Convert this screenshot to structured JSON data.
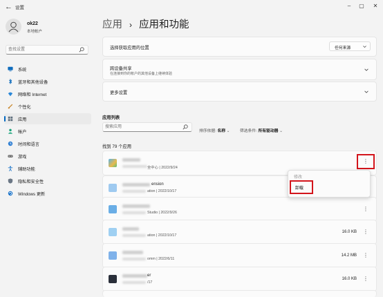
{
  "window": {
    "app_title": "设置",
    "back_icon": "back-arrow-icon",
    "controls": [
      "–",
      "▢",
      "✕"
    ]
  },
  "profile": {
    "name": "ok22",
    "account_type": "本地帐户"
  },
  "search": {
    "placeholder": "查找设置"
  },
  "sidebar": {
    "items": [
      {
        "label": "系统",
        "icon": "monitor-icon",
        "color": "#0f6cbd"
      },
      {
        "label": "蓝牙和其他设备",
        "icon": "bluetooth-icon",
        "color": "#0f6cbd"
      },
      {
        "label": "网络和 Internet",
        "icon": "wifi-icon",
        "color": "#2b88d8"
      },
      {
        "label": "个性化",
        "icon": "brush-icon",
        "color": "#c8862a"
      },
      {
        "label": "应用",
        "icon": "apps-icon",
        "color": "#5b6b7a",
        "active": true
      },
      {
        "label": "帐户",
        "icon": "person-icon",
        "color": "#1aa37a"
      },
      {
        "label": "时间和语言",
        "icon": "globe-clock-icon",
        "color": "#2f7fd3"
      },
      {
        "label": "游戏",
        "icon": "gamepad-icon",
        "color": "#6b6b6b"
      },
      {
        "label": "辅助功能",
        "icon": "accessibility-icon",
        "color": "#1a73c9"
      },
      {
        "label": "隐私和安全性",
        "icon": "shield-icon",
        "color": "#6b7785"
      },
      {
        "label": "Windows 更新",
        "icon": "update-icon",
        "color": "#1a73c9"
      }
    ]
  },
  "header": {
    "parent": "应用",
    "separator": "›",
    "current": "应用和功能"
  },
  "settings": {
    "install_location": {
      "title": "选择获取应用的位置",
      "value": "任何来源"
    },
    "share_across": {
      "title": "跨设备共享",
      "subtitle": "在连接到你的帐户的其他设备上继续体验"
    },
    "more": {
      "title": "更多设置"
    }
  },
  "app_list": {
    "section_label": "应用列表",
    "search_placeholder": "搜索应用",
    "sort_prefix": "排序依据:",
    "sort_value": "名称",
    "filter_prefix": "筛选条件:",
    "filter_value": "所有驱动器",
    "count_label": "找到 79 个应用"
  },
  "apps": [
    {
      "name_tail": "",
      "meta": "全中心  |  2022/9/24",
      "size": "",
      "icon_color": "#4aa3d8"
    },
    {
      "name_tail": "ension",
      "meta": "ation  |  2022/10/17",
      "size": "",
      "icon_color": "#7fb8e8"
    },
    {
      "name_tail": "",
      "meta": "Studio  |  2022/9/26",
      "size": "",
      "icon_color": "#5aa0dc"
    },
    {
      "name_tail": "",
      "meta": "ation  |  2022/10/17",
      "size": "16.0 KB",
      "icon_color": "#8cc4ee"
    },
    {
      "name_tail": "",
      "meta": "omm  |  2022/6/11",
      "size": "14.2 MB",
      "icon_color": "#6fa8e4"
    },
    {
      "name_tail": "er",
      "meta": "/17",
      "size": "16.0 KB",
      "icon_color": "#2a2f3a"
    }
  ],
  "context_menu": {
    "items": [
      {
        "label": "修改",
        "disabled": true
      },
      {
        "label": "卸载",
        "disabled": false
      }
    ]
  },
  "more_glyph": "⋮"
}
